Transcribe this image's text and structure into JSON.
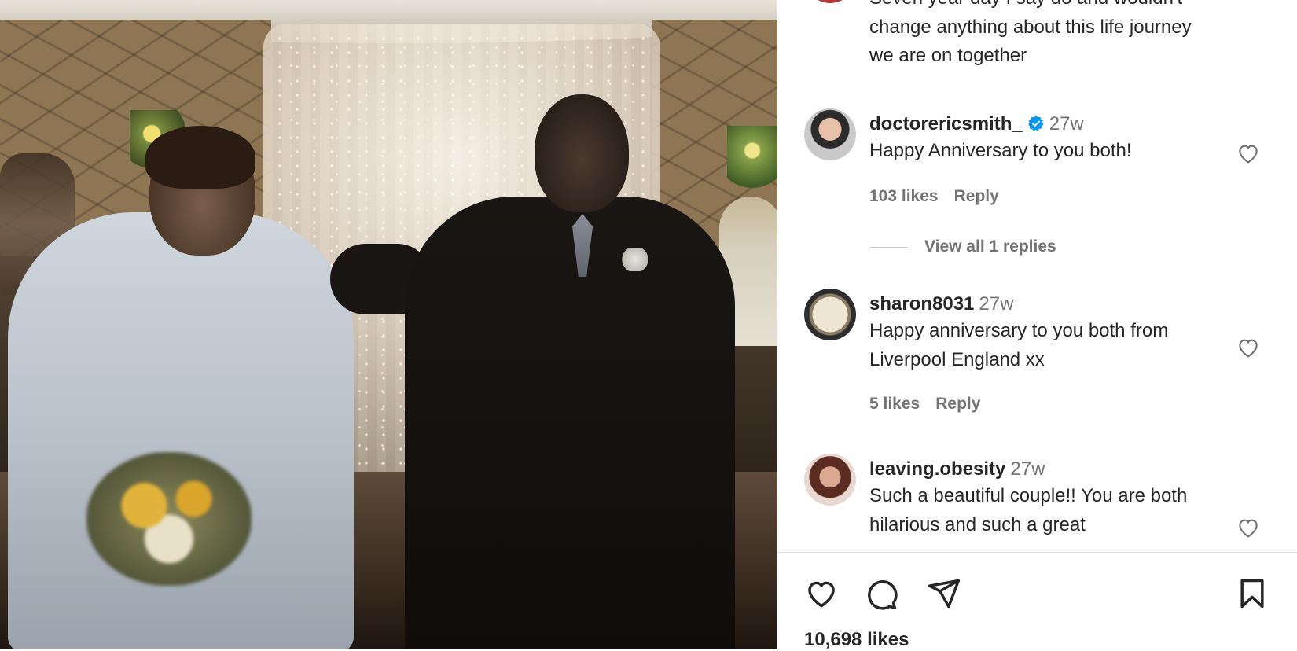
{
  "post": {
    "image_alt_icon": "wedding-photo",
    "caption_lines": [
      "Seven year day I say do and wouldn't",
      "change anything about this life journey",
      "we are on together"
    ],
    "likes": "10,698 likes"
  },
  "comments": [
    {
      "user": "doctorericsmith_",
      "verified": true,
      "time": "27w",
      "text": "Happy Anniversary to you both!",
      "likes": "103 likes",
      "reply": "Reply",
      "view_replies": "View all 1 replies"
    },
    {
      "user": "sharon8031",
      "verified": false,
      "time": "27w",
      "text": "Happy anniversary to you both from Liverpool England xx",
      "likes": "5 likes",
      "reply": "Reply"
    },
    {
      "user": "leaving.obesity",
      "verified": false,
      "time": "27w",
      "text": "Such a beautiful couple!! You are both hilarious and such a great"
    }
  ],
  "actions": {
    "like_icon": "heart-icon",
    "comment_icon": "comment-icon",
    "share_icon": "share-icon",
    "save_icon": "bookmark-icon"
  },
  "colors": {
    "text": "#262626",
    "muted": "#737373",
    "verified": "#0095f6",
    "divider": "#dbdbdb"
  }
}
